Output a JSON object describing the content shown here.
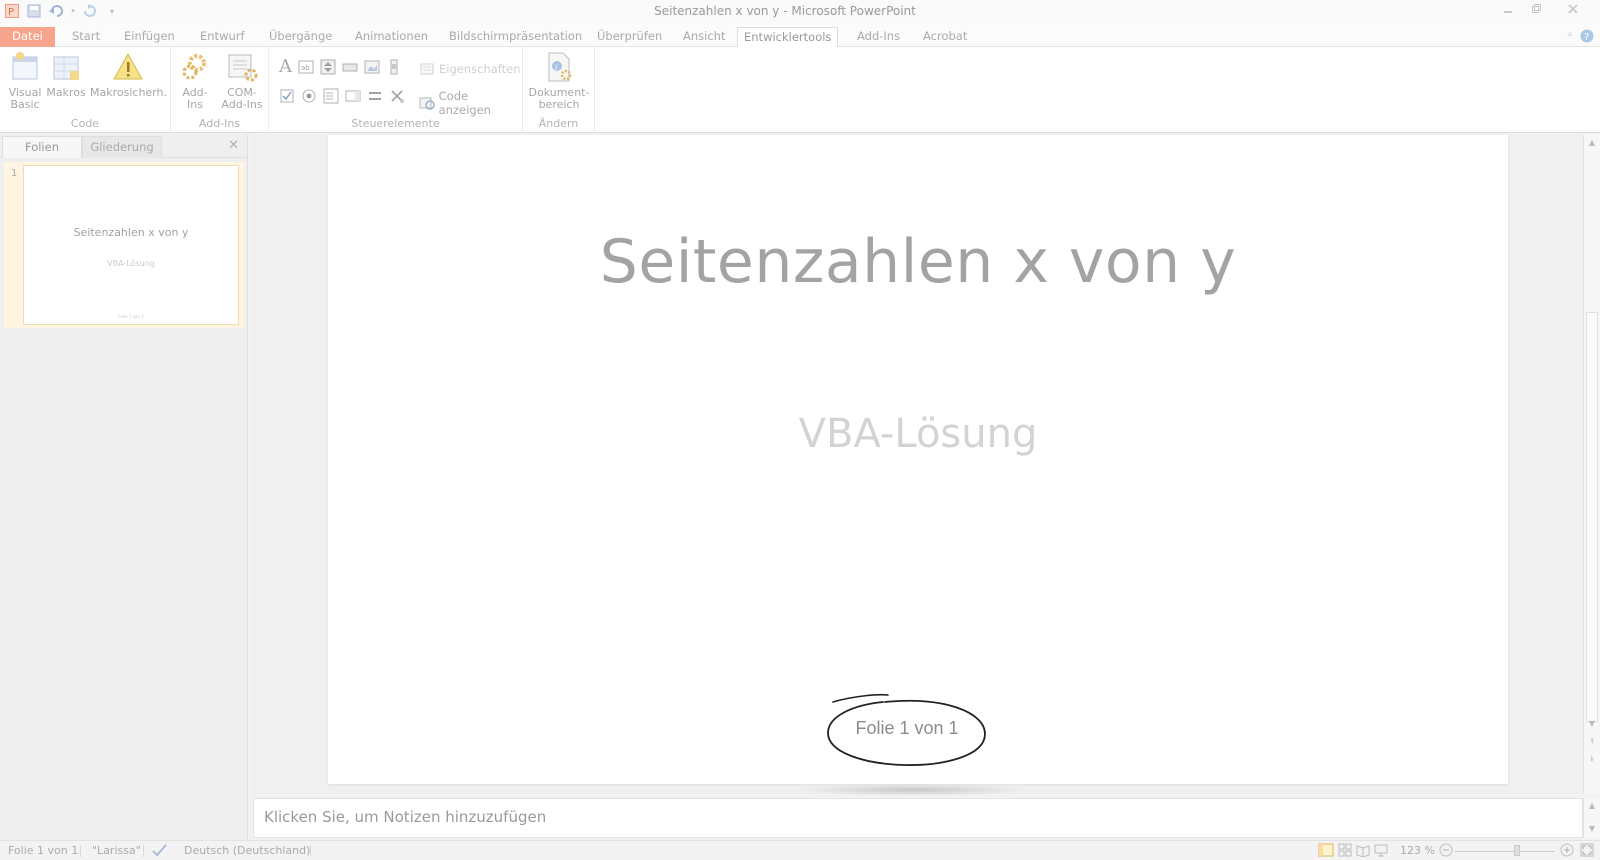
{
  "window": {
    "title": "Seitenzahlen x von y  -  Microsoft PowerPoint",
    "app_icon_letter": "P",
    "controls": [
      "minimize",
      "restore",
      "close"
    ]
  },
  "ribbon_tabs": [
    {
      "label": "Datei",
      "kind": "file"
    },
    {
      "label": "Start"
    },
    {
      "label": "Einfügen"
    },
    {
      "label": "Entwurf"
    },
    {
      "label": "Übergänge"
    },
    {
      "label": "Animationen"
    },
    {
      "label": "Bildschirmpräsentation"
    },
    {
      "label": "Überprüfen"
    },
    {
      "label": "Ansicht"
    },
    {
      "label": "Entwicklertools",
      "active": true
    },
    {
      "label": "Add-Ins"
    },
    {
      "label": "Acrobat"
    }
  ],
  "ribbon": {
    "code_group": {
      "label": "Code",
      "visual_basic": "Visual Basic",
      "visual_basic_l1": "Visual",
      "visual_basic_l2": "Basic",
      "makros": "Makros",
      "makrosicherheit": "Makrosicherh."
    },
    "addins_group": {
      "label": "Add-Ins",
      "addins": "Add-Ins",
      "com_l1": "COM-",
      "com_l2": "Add-Ins"
    },
    "controls_group": {
      "label": "Steuerelemente",
      "eigenschaften": "Eigenschaften",
      "code_anzeigen": "Code anzeigen"
    },
    "modify_group": {
      "label": "Ändern",
      "doc_l1": "Dokument-",
      "doc_l2": "bereich"
    }
  },
  "left_pane": {
    "tabs": [
      "Folien",
      "Gliederung"
    ],
    "active_tab": "Folien",
    "thumbnail": {
      "number": "1",
      "title": "Seitenzahlen x von y",
      "subtitle": "VBA-Lösung",
      "footer": "Folie 1 von 1"
    }
  },
  "slide": {
    "title": "Seitenzahlen x von y",
    "subtitle": "VBA-Lösung",
    "footer": "Folie 1 von 1"
  },
  "notes": {
    "placeholder": "Klicken Sie, um Notizen hinzuzufügen"
  },
  "status_bar": {
    "slide_indicator": "Folie 1 von 1",
    "theme": "\"Larissa\"",
    "language": "Deutsch (Deutschland)",
    "zoom": "123 %",
    "zoom_fraction": 0.62
  },
  "colors": {
    "file_tab": "#f6a48c",
    "thumb_highlight": "#fff5e0",
    "help_icon": "#aac7e8"
  }
}
